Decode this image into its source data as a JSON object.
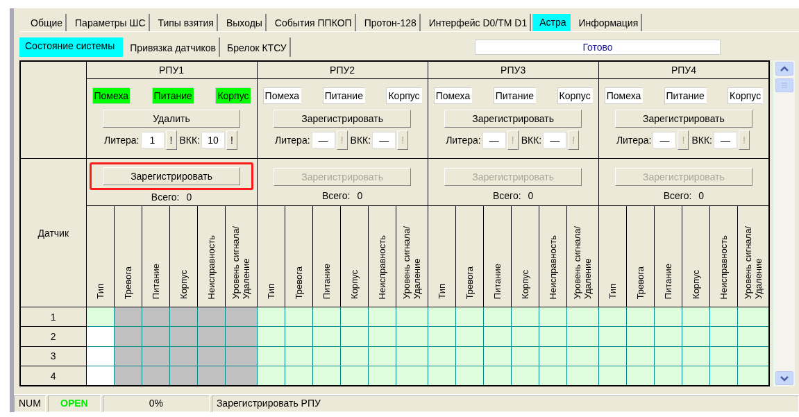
{
  "tabs": [
    {
      "label": "Общие",
      "selected": false
    },
    {
      "label": "Параметры ШС",
      "selected": false
    },
    {
      "label": "Типы взятия",
      "selected": false
    },
    {
      "label": "Выходы",
      "selected": false
    },
    {
      "label": "События ППКОП",
      "selected": false
    },
    {
      "label": "Протон-128",
      "selected": false
    },
    {
      "label": "Интерфейс D0/TM D1",
      "selected": false
    },
    {
      "label": "Астра",
      "selected": true
    },
    {
      "label": "Информация",
      "selected": false
    }
  ],
  "subtabs": [
    {
      "label": "Состояние системы",
      "selected": true
    },
    {
      "label": "Привязка датчиков",
      "selected": false
    },
    {
      "label": "Брелок КТСУ",
      "selected": false
    }
  ],
  "status_field": "Готово",
  "sensor_header": "Датчик",
  "rows": [
    "1",
    "2",
    "3",
    "4"
  ],
  "rpus": [
    {
      "title": "РПУ1",
      "indicators": [
        {
          "label": "Помеха",
          "on": true
        },
        {
          "label": "Питание",
          "on": true
        },
        {
          "label": "Корпус",
          "on": true
        }
      ],
      "action_button": "Удалить",
      "litera_label": "Литера:",
      "litera": "1",
      "litera_button": {
        "label": "!",
        "disabled": false
      },
      "vkk_label": "ВКК:",
      "vkk": "10",
      "vkk_button": {
        "label": "!",
        "disabled": false
      },
      "register_button": {
        "label": "Зарегистрировать",
        "disabled": false,
        "highlighted": true
      },
      "total_label": "Всего:",
      "total": "0",
      "columns": [
        "Тип",
        "Тревога",
        "Питание",
        "Корпус",
        "Неисправность",
        "Уровень сигнала/ Удаление"
      ],
      "cells": [
        [
          {
            "kind": "free"
          },
          {
            "kind": "locked"
          },
          {
            "kind": "locked"
          },
          {
            "kind": "locked"
          },
          {
            "kind": "locked"
          },
          {
            "kind": "locked"
          }
        ],
        [
          {
            "kind": "empty"
          },
          {
            "kind": "locked"
          },
          {
            "kind": "locked"
          },
          {
            "kind": "locked"
          },
          {
            "kind": "locked"
          },
          {
            "kind": "locked"
          }
        ],
        [
          {
            "kind": "empty"
          },
          {
            "kind": "locked"
          },
          {
            "kind": "locked"
          },
          {
            "kind": "locked"
          },
          {
            "kind": "locked"
          },
          {
            "kind": "locked"
          }
        ],
        [
          {
            "kind": "empty"
          },
          {
            "kind": "locked"
          },
          {
            "kind": "locked"
          },
          {
            "kind": "locked"
          },
          {
            "kind": "locked"
          },
          {
            "kind": "locked"
          }
        ]
      ]
    },
    {
      "title": "РПУ2",
      "indicators": [
        {
          "label": "Помеха",
          "on": false
        },
        {
          "label": "Питание",
          "on": false
        },
        {
          "label": "Корпус",
          "on": false
        }
      ],
      "action_button": "Зарегистрировать",
      "litera_label": "Литера:",
      "litera": "—",
      "litera_button": {
        "label": "!",
        "disabled": true
      },
      "vkk_label": "ВКК:",
      "vkk": "—",
      "vkk_button": {
        "label": "!",
        "disabled": true
      },
      "register_button": {
        "label": "Зарегистрировать",
        "disabled": true,
        "highlighted": false
      },
      "total_label": "Всего:",
      "total": "0",
      "columns": [
        "Тип",
        "Тревога",
        "Питание",
        "Корпус",
        "Неисправность",
        "Уровень сигнала/ Удаление"
      ],
      "cells": [
        [
          {
            "kind": "free"
          },
          {
            "kind": "free"
          },
          {
            "kind": "free"
          },
          {
            "kind": "free"
          },
          {
            "kind": "free"
          },
          {
            "kind": "free"
          }
        ],
        [
          {
            "kind": "free"
          },
          {
            "kind": "free"
          },
          {
            "kind": "free"
          },
          {
            "kind": "free"
          },
          {
            "kind": "free"
          },
          {
            "kind": "free"
          }
        ],
        [
          {
            "kind": "free"
          },
          {
            "kind": "free"
          },
          {
            "kind": "free"
          },
          {
            "kind": "free"
          },
          {
            "kind": "free"
          },
          {
            "kind": "free"
          }
        ],
        [
          {
            "kind": "free"
          },
          {
            "kind": "free"
          },
          {
            "kind": "free"
          },
          {
            "kind": "free"
          },
          {
            "kind": "free"
          },
          {
            "kind": "free"
          }
        ]
      ]
    },
    {
      "title": "РПУ3",
      "indicators": [
        {
          "label": "Помеха",
          "on": false
        },
        {
          "label": "Питание",
          "on": false
        },
        {
          "label": "Корпус",
          "on": false
        }
      ],
      "action_button": "Зарегистрировать",
      "litera_label": "Литера:",
      "litera": "—",
      "litera_button": {
        "label": "!",
        "disabled": true
      },
      "vkk_label": "ВКК:",
      "vkk": "—",
      "vkk_button": {
        "label": "!",
        "disabled": true
      },
      "register_button": {
        "label": "Зарегистрировать",
        "disabled": true,
        "highlighted": false
      },
      "total_label": "Всего:",
      "total": "0",
      "columns": [
        "Тип",
        "Тревога",
        "Питание",
        "Корпус",
        "Неисправность",
        "Уровень сигнала/ Удаление"
      ],
      "cells": [
        [
          {
            "kind": "free"
          },
          {
            "kind": "free"
          },
          {
            "kind": "free"
          },
          {
            "kind": "free"
          },
          {
            "kind": "free"
          },
          {
            "kind": "free"
          }
        ],
        [
          {
            "kind": "free"
          },
          {
            "kind": "free"
          },
          {
            "kind": "free"
          },
          {
            "kind": "free"
          },
          {
            "kind": "free"
          },
          {
            "kind": "free"
          }
        ],
        [
          {
            "kind": "free"
          },
          {
            "kind": "free"
          },
          {
            "kind": "free"
          },
          {
            "kind": "free"
          },
          {
            "kind": "free"
          },
          {
            "kind": "free"
          }
        ],
        [
          {
            "kind": "free"
          },
          {
            "kind": "free"
          },
          {
            "kind": "free"
          },
          {
            "kind": "free"
          },
          {
            "kind": "free"
          },
          {
            "kind": "free"
          }
        ]
      ]
    },
    {
      "title": "РПУ4",
      "indicators": [
        {
          "label": "Помеха",
          "on": false
        },
        {
          "label": "Питание",
          "on": false
        },
        {
          "label": "Корпус",
          "on": false
        }
      ],
      "action_button": "Зарегистрировать",
      "litera_label": "Литера:",
      "litera": "—",
      "litera_button": {
        "label": "!",
        "disabled": true
      },
      "vkk_label": "ВКК:",
      "vkk": "—",
      "vkk_button": {
        "label": "!",
        "disabled": true
      },
      "register_button": {
        "label": "Зарегистрировать",
        "disabled": true,
        "highlighted": false
      },
      "total_label": "Всего:",
      "total": "0",
      "columns": [
        "Тип",
        "Тревога",
        "Питание",
        "Корпус",
        "Неисправность",
        "Уровень сигнала/ Удаление"
      ],
      "cells": [
        [
          {
            "kind": "free"
          },
          {
            "kind": "free"
          },
          {
            "kind": "free"
          },
          {
            "kind": "free"
          },
          {
            "kind": "free"
          },
          {
            "kind": "free"
          }
        ],
        [
          {
            "kind": "free"
          },
          {
            "kind": "free"
          },
          {
            "kind": "free"
          },
          {
            "kind": "free"
          },
          {
            "kind": "free"
          },
          {
            "kind": "free"
          }
        ],
        [
          {
            "kind": "free"
          },
          {
            "kind": "free"
          },
          {
            "kind": "free"
          },
          {
            "kind": "free"
          },
          {
            "kind": "free"
          },
          {
            "kind": "free"
          }
        ],
        [
          {
            "kind": "free"
          },
          {
            "kind": "free"
          },
          {
            "kind": "free"
          },
          {
            "kind": "free"
          },
          {
            "kind": "free"
          },
          {
            "kind": "free"
          }
        ]
      ]
    }
  ],
  "status_bar": [
    {
      "kind": "plain",
      "text": "NUM"
    },
    {
      "kind": "ok",
      "text": "OPEN"
    },
    {
      "kind": "center",
      "text": "0%"
    },
    {
      "kind": "message",
      "text": "Зарегистрировать РПУ"
    }
  ]
}
